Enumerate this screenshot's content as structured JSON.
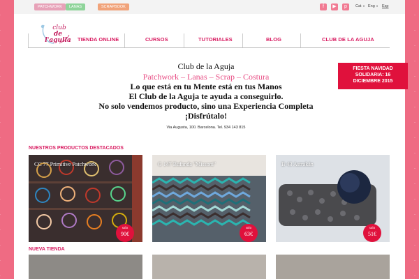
{
  "topbar": {
    "tags": [
      {
        "label": "Patchwork",
        "color": "#e7a2b8"
      },
      {
        "label": "Lanas",
        "color": "#8fd49a"
      },
      {
        "label": "Scrapbook",
        "color": "#f1a37a"
      }
    ],
    "social": [
      {
        "name": "facebook-icon",
        "glyph": "f"
      },
      {
        "name": "youtube-icon",
        "glyph": "▶"
      },
      {
        "name": "pinterest-icon",
        "glyph": "p"
      }
    ],
    "languages": [
      "Cat",
      "Eng",
      "Esp"
    ]
  },
  "logo": {
    "line1": "club",
    "line2": "de l'agulla"
  },
  "nav": {
    "items": [
      "Tienda Online",
      "Cursos",
      "Tutoriales",
      "Blog",
      "Club de la Aguja"
    ]
  },
  "hero": {
    "title": "Club de la Aguja",
    "subtitle": "Patchwork – Lanas – Scrap – Costura",
    "line1": "Lo que está en tu Mente está en tus Manos",
    "line2": "El Club de la Aguja te ayuda a conseguirlo.",
    "line3": "No solo vendemos producto, sino una Experiencia Completa",
    "line4": "¡Disfrútalo!",
    "address": "Via Augusta, 100. Barcelona. Tel. 934 143 815"
  },
  "event": {
    "line1": "FIESTA NAVIDAD",
    "line2": "SOLIDARIA: 16",
    "line3": "DICIEMBRE 2015"
  },
  "featured": {
    "title": "Nuestros productos destacados",
    "products": [
      {
        "label": "CC 77 Primitive Patchwork",
        "badge": "solo",
        "price": "90€"
      },
      {
        "label": "G 147 Bufanda \"Missoni\"",
        "badge": "solo",
        "price": "63€"
      },
      {
        "label": "B 43 Astrakán",
        "badge": "solo",
        "price": "51€"
      }
    ]
  },
  "store": {
    "title": "Nueva tienda"
  }
}
